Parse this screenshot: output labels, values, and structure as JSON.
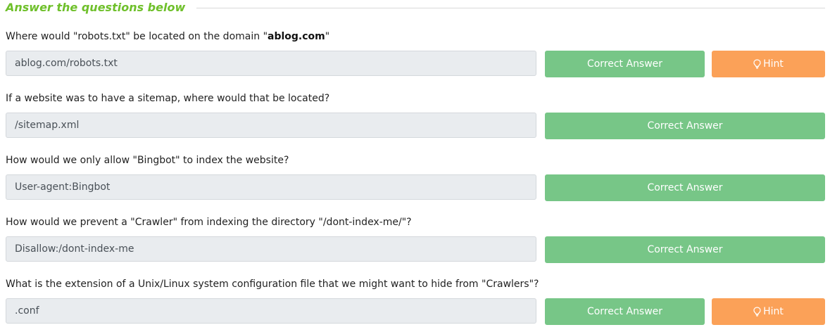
{
  "section": {
    "title": "Answer the questions below"
  },
  "questions": [
    {
      "text_before": "Where would \"robots.txt\" be located on the domain \"",
      "text_bold": "ablog.com",
      "text_after": "\"",
      "answer": "ablog.com/robots.txt",
      "button_label": "Correct Answer",
      "hint_label": "Hint"
    },
    {
      "text": "If a website was to have a sitemap, where would that be located?",
      "answer": "/sitemap.xml",
      "button_label": "Correct Answer"
    },
    {
      "text": "How would we only allow \"Bingbot\" to index the website?",
      "answer": "User-agent:Bingbot",
      "button_label": "Correct Answer"
    },
    {
      "text": "How would we prevent a \"Crawler\" from indexing the directory \"/dont-index-me/\"?",
      "answer": "Disallow:/dont-index-me",
      "button_label": "Correct Answer"
    },
    {
      "text": "What is the extension of a Unix/Linux system configuration file that we might want to hide from \"Crawlers\"?",
      "answer": ".conf",
      "button_label": "Correct Answer",
      "hint_label": "Hint"
    }
  ],
  "colors": {
    "title": "#6fc02b",
    "correct_button": "#77c687",
    "hint_button": "#fba158",
    "answer_box": "#e9ecef"
  },
  "icons": {
    "hint": "lightbulb-icon"
  }
}
